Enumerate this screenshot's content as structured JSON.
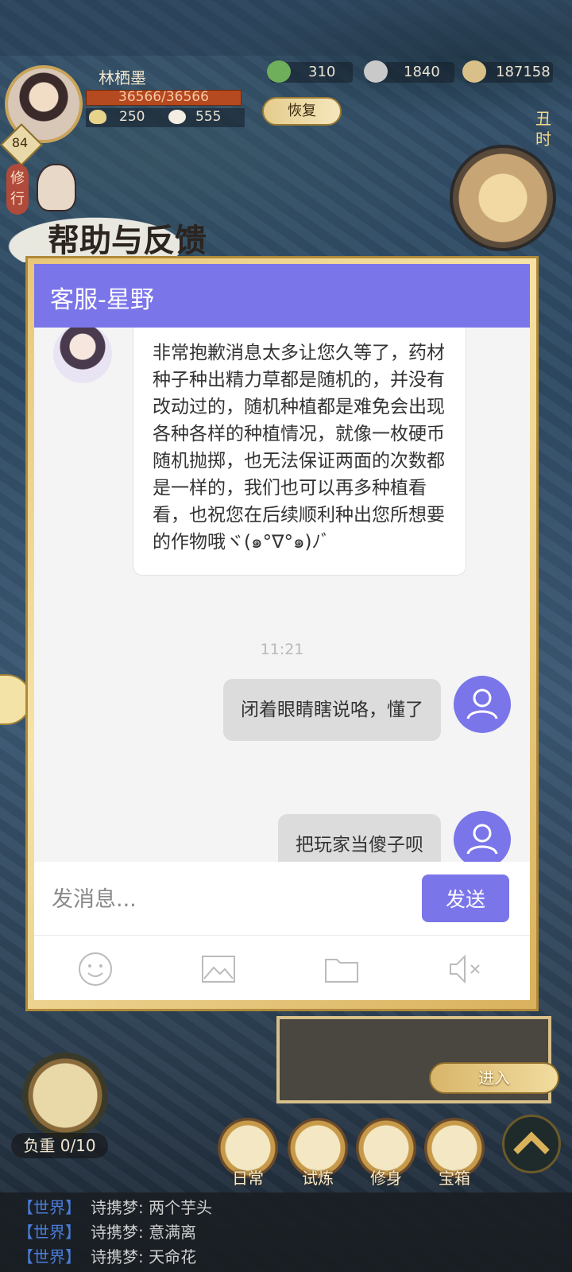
{
  "hud": {
    "player_name": "林栖墨",
    "level": "84",
    "hp": "36566/36566",
    "stat_food": "250",
    "stat_bun": "555",
    "resources": [
      "310",
      "1840",
      "187158"
    ],
    "recover_label": "恢复",
    "time_label": "丑时",
    "cultivate_label": "修行"
  },
  "dialog": {
    "title": "帮助与反馈",
    "header": "客服-星野",
    "agent_message": "非常抱歉消息太多让您久等了，药材种子种出精力草都是随机的，并没有改动过的，随机种植都是难免会出现各种各样的种植情况，就像一枚硬币随机抛掷，也无法保证两面的次数都是一样的，我们也可以再多种植看看，也祝您在后续顺利种出您所想要的作物哦ヾ(๑°∇°๑)ﾉﾞ",
    "timestamp": "11:21",
    "user_messages": [
      "闭着眼睛瞎说咯，懂了",
      "把玩家当傻子呗"
    ],
    "input_placeholder": "发消息...",
    "send_label": "发送",
    "tools": [
      "emoji-icon",
      "image-icon",
      "folder-icon",
      "mute-icon"
    ]
  },
  "bottom": {
    "weight_label": "负重 0/10",
    "enter_label": "进入",
    "nav": [
      "日常",
      "试炼",
      "修身",
      "宝箱"
    ]
  },
  "world_chat": [
    {
      "channel": "【世界】",
      "text": "诗携梦: 两个芋头"
    },
    {
      "channel": "【世界】",
      "text": "诗携梦: 意满离"
    },
    {
      "channel": "【世界】",
      "text": "诗携梦: 天命花"
    }
  ],
  "colors": {
    "accent": "#7b75ea",
    "frame_gold": "#e8c77a",
    "chat_channel": "#4a7bd8"
  }
}
